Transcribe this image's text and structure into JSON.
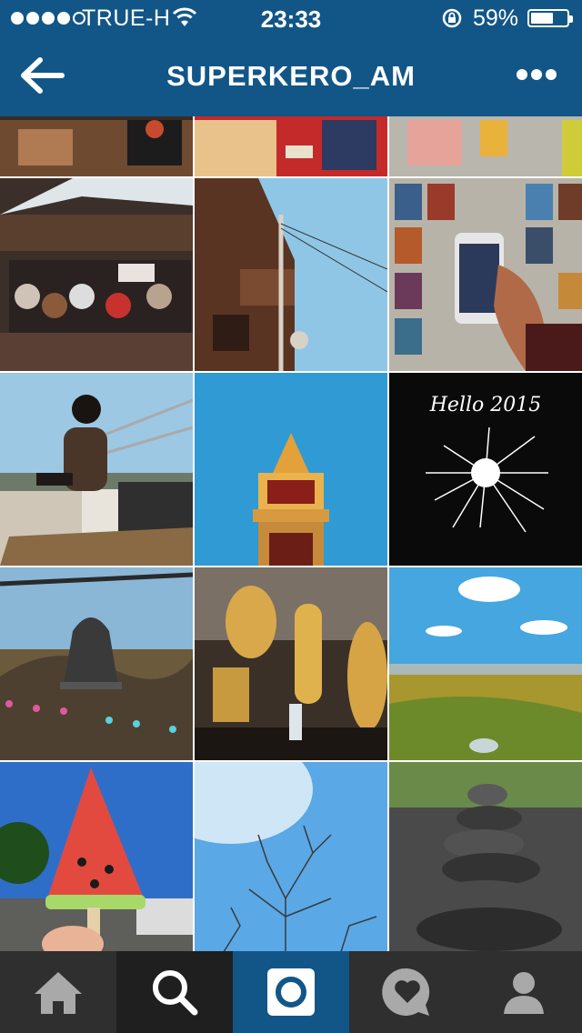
{
  "status_bar": {
    "carrier": "TRUE-H",
    "time": "23:33",
    "battery_percent": "59%",
    "battery_level": 0.59,
    "signal_bars_filled": 4,
    "signal_bars_total": 5
  },
  "header": {
    "title": "SUPERKERO_AM",
    "background_color": "#125688"
  },
  "grid": {
    "photos": [
      {
        "label": "market stall"
      },
      {
        "label": "welcome shop"
      },
      {
        "label": "street with corn"
      },
      {
        "label": "wooden shop with hats"
      },
      {
        "label": "old wooden house"
      },
      {
        "label": "phone held over postcards"
      },
      {
        "label": "person sitting on bridge"
      },
      {
        "label": "temple tower"
      },
      {
        "label": "sparkler",
        "caption": "Hello 2015"
      },
      {
        "label": "bell on wire"
      },
      {
        "label": "golden buddhas"
      },
      {
        "label": "valley view"
      },
      {
        "label": "watermelon popsicle"
      },
      {
        "label": "sky and branches"
      },
      {
        "label": "stacked stones"
      }
    ]
  },
  "tab_bar": {
    "tabs": [
      {
        "name": "home",
        "icon": "home-icon",
        "active": false
      },
      {
        "name": "search",
        "icon": "search-icon",
        "active": false
      },
      {
        "name": "camera",
        "icon": "camera-icon",
        "active": true
      },
      {
        "name": "activity",
        "icon": "heart-bubble-icon",
        "active": false
      },
      {
        "name": "profile",
        "icon": "profile-icon",
        "active": false
      }
    ]
  }
}
